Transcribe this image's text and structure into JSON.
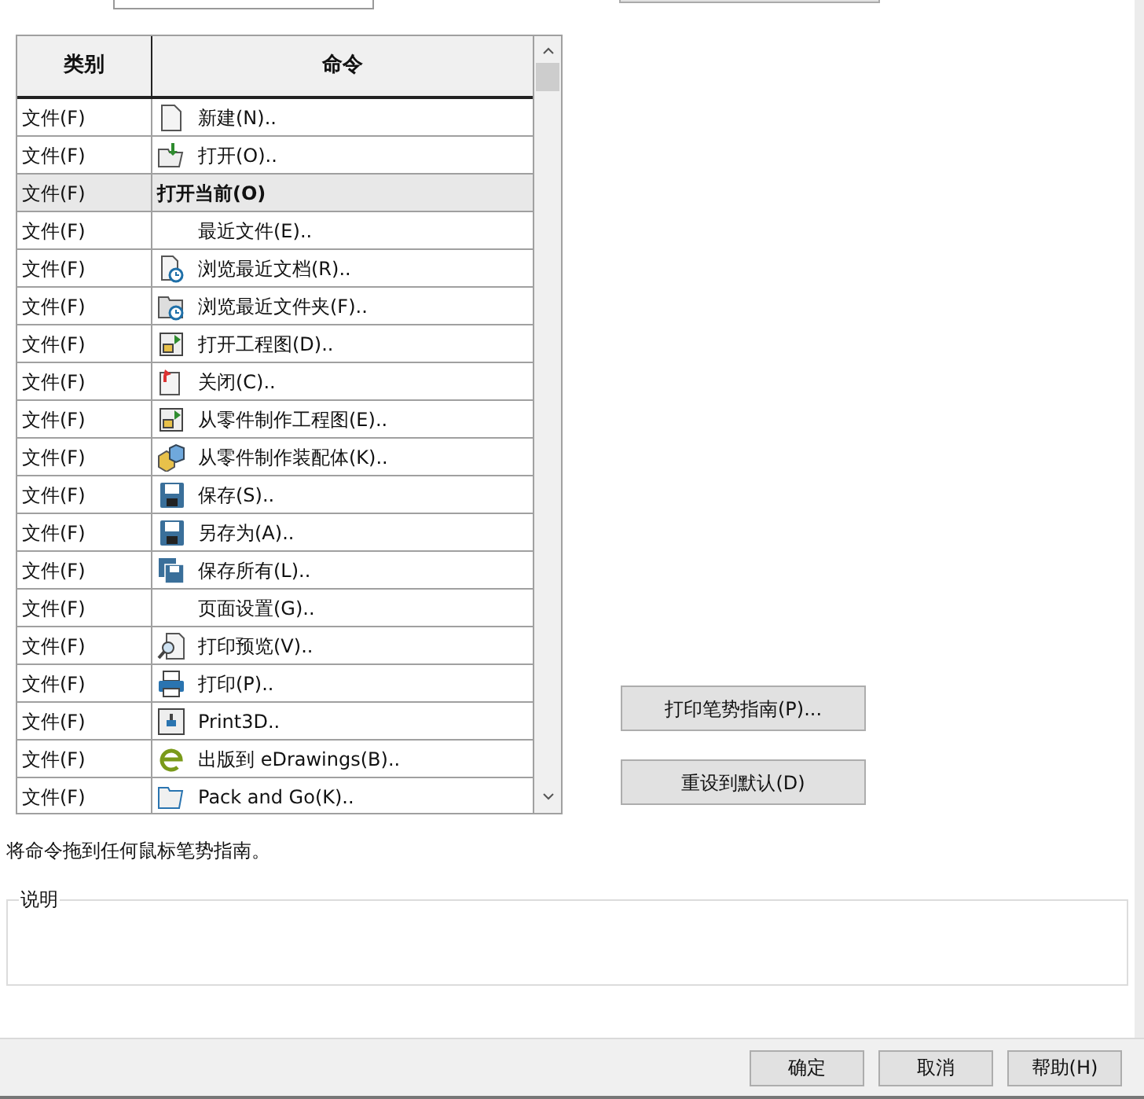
{
  "table": {
    "columns": [
      "类别",
      "命令"
    ],
    "rows": [
      {
        "kind": "command",
        "category": "文件(F)",
        "command": "新建(N).."
      },
      {
        "kind": "command",
        "category": "文件(F)",
        "command": "打开(O).."
      },
      {
        "kind": "group",
        "category": "文件(F)",
        "command": "打开当前(O)"
      },
      {
        "kind": "command",
        "category": "文件(F)",
        "command": "最近文件(E).."
      },
      {
        "kind": "command",
        "category": "文件(F)",
        "command": "浏览最近文档(R).."
      },
      {
        "kind": "command",
        "category": "文件(F)",
        "command": "浏览最近文件夹(F).."
      },
      {
        "kind": "command",
        "category": "文件(F)",
        "command": "打开工程图(D).."
      },
      {
        "kind": "command",
        "category": "文件(F)",
        "command": "关闭(C).."
      },
      {
        "kind": "command",
        "category": "文件(F)",
        "command": "从零件制作工程图(E).."
      },
      {
        "kind": "command",
        "category": "文件(F)",
        "command": "从零件制作装配体(K).."
      },
      {
        "kind": "command",
        "category": "文件(F)",
        "command": "保存(S).."
      },
      {
        "kind": "command",
        "category": "文件(F)",
        "command": "另存为(A).."
      },
      {
        "kind": "command",
        "category": "文件(F)",
        "command": "保存所有(L).."
      },
      {
        "kind": "command",
        "category": "文件(F)",
        "command": "页面设置(G).."
      },
      {
        "kind": "command",
        "category": "文件(F)",
        "command": "打印预览(V).."
      },
      {
        "kind": "command",
        "category": "文件(F)",
        "command": "打印(P).."
      },
      {
        "kind": "command",
        "category": "文件(F)",
        "command": "Print3D.."
      },
      {
        "kind": "command",
        "category": "文件(F)",
        "command": "出版到 eDrawings(B).."
      },
      {
        "kind": "command",
        "category": "文件(F)",
        "command": "Pack and Go(K).."
      }
    ]
  },
  "side_buttons": [
    "打印笔势指南(P)...",
    "重设到默认(D)"
  ],
  "hint": "将命令拖到任何鼠标笔势指南。",
  "description": {
    "label": "说明"
  },
  "footer_buttons": [
    "确定",
    "取消",
    "帮助(H)"
  ]
}
